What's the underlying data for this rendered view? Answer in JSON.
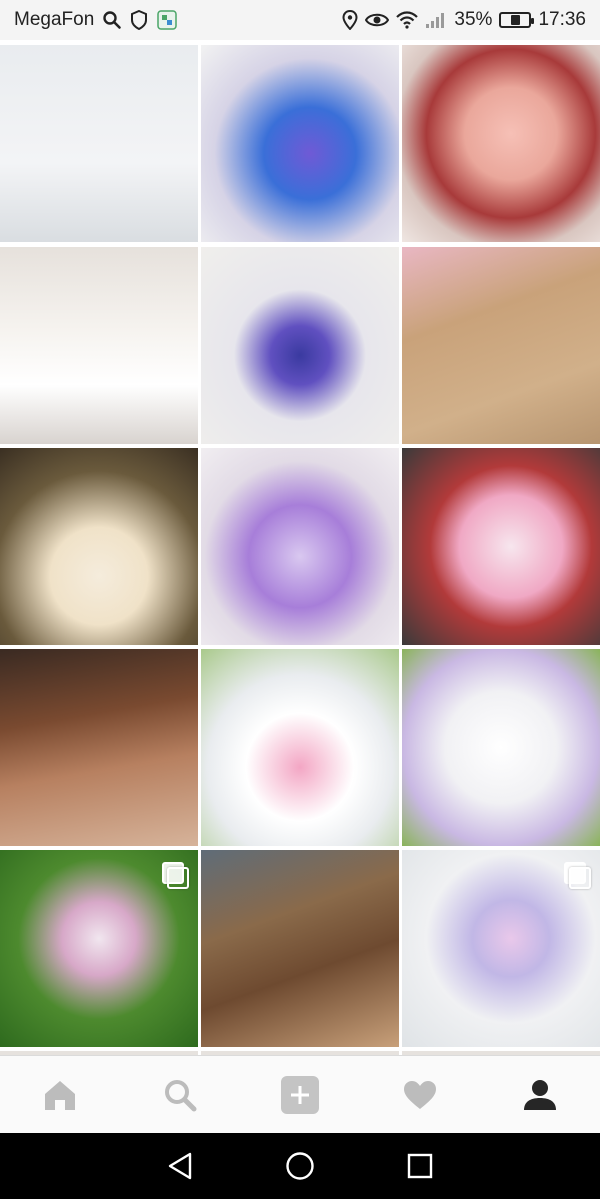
{
  "status_bar": {
    "carrier": "MegaFon",
    "battery_percent": "35%",
    "battery_level": 0.35,
    "time": "17:36"
  },
  "grid": {
    "tiles": [
      {
        "name": "photo-ladybug-cake",
        "bg": "linear-gradient(180deg,#e9ecef 0%,#f3f4f6 60%,#d9dde1 100%)",
        "multi": false
      },
      {
        "name": "photo-galaxy-cake",
        "bg": "radial-gradient(circle at 55% 55%,#6f5ad6 0%,#3a6fd8 30%,#d6d3e6 62%,#f2f2f2 100%)",
        "multi": false
      },
      {
        "name": "photo-rose-cupcake",
        "bg": "radial-gradient(circle at 55% 45%,#f6c0b6 0%,#eaa79b 30%,#a83a3a 55%,#d9c6c0 75%,#efe6e2 100%)",
        "multi": false
      },
      {
        "name": "photo-bride-dress",
        "bg": "linear-gradient(180deg,#e6e1dc 0%,#f5f2ee 40%,#ffffff 70%,#d8d3cf 100%)",
        "multi": false
      },
      {
        "name": "photo-happy-birthday-cake",
        "bg": "radial-gradient(circle at 50% 55%,#3a3aa0 0%,#6050c0 20%,#e7e6ec 45%,#f0efec 100%)",
        "multi": false
      },
      {
        "name": "photo-gift-box",
        "bg": "linear-gradient(160deg,#e9b7c3 0%,#c9a27a 35%,#d1b08a 70%,#b79570 100%)",
        "multi": false
      },
      {
        "name": "photo-pavlova",
        "bg": "radial-gradient(circle at 50% 65%,#f5ecdc 0%,#f0e2c8 30%,#6a5a3c 65%,#3a2f22 100%)",
        "multi": false
      },
      {
        "name": "photo-berry-purple-cake",
        "bg": "radial-gradient(circle at 50% 55%,#d9c8f0 0%,#a77ed9 35%,#e2dbe6 65%,#f1eef1 100%)",
        "multi": false
      },
      {
        "name": "photo-strawberry-pink-cake",
        "bg": "radial-gradient(circle at 55% 50%,#f7e6ee 0%,#f0a8c4 35%,#b23a3a 55%,#3a3a3a 100%)",
        "multi": false
      },
      {
        "name": "photo-chocolate-eclairs",
        "bg": "linear-gradient(170deg,#3a2a22 0%,#7a4a30 35%,#b78060 60%,#d6b39a 100%)",
        "multi": false
      },
      {
        "name": "photo-berry-face-cake",
        "bg": "radial-gradient(circle at 50% 60%,#f3a6c4 0%,#ffffff 35%,#e9ecef 60%,#a9c98b 100%)",
        "multi": false
      },
      {
        "name": "photo-easter-cake-wrapped",
        "bg": "radial-gradient(circle at 50% 50%,#ffffff 0%,#f1f1f4 40%,#c9b8e3 70%,#8ab45a 100%)",
        "multi": false
      },
      {
        "name": "photo-easter-nest-cake",
        "bg": "radial-gradient(circle at 50% 45%,#f1e6ef 0%,#d7a8c8 25%,#4d8a2e 55%,#2e6a1e 100%)",
        "multi": true
      },
      {
        "name": "photo-chocolate-eclairs-board",
        "bg": "linear-gradient(160deg,#5f6c78 0%,#8a6a4a 35%,#6e4a30 60%,#c8a07a 100%)",
        "multi": false
      },
      {
        "name": "photo-pastel-cake-stand",
        "bg": "radial-gradient(circle at 55% 45%,#e9c8ea 0%,#c1b7e6 25%,#f0f1f3 55%,#dfe3e6 100%)",
        "multi": true
      }
    ]
  },
  "bottom_nav": {
    "items": [
      "home-tab",
      "search-tab",
      "new-post-tab",
      "activity-tab",
      "profile-tab"
    ]
  },
  "system_nav": {
    "items": [
      "back",
      "home",
      "recents"
    ]
  },
  "colors": {
    "nav_icon": "#bcbcbc",
    "nav_icon_active": "#262626",
    "status_text": "#222222"
  }
}
